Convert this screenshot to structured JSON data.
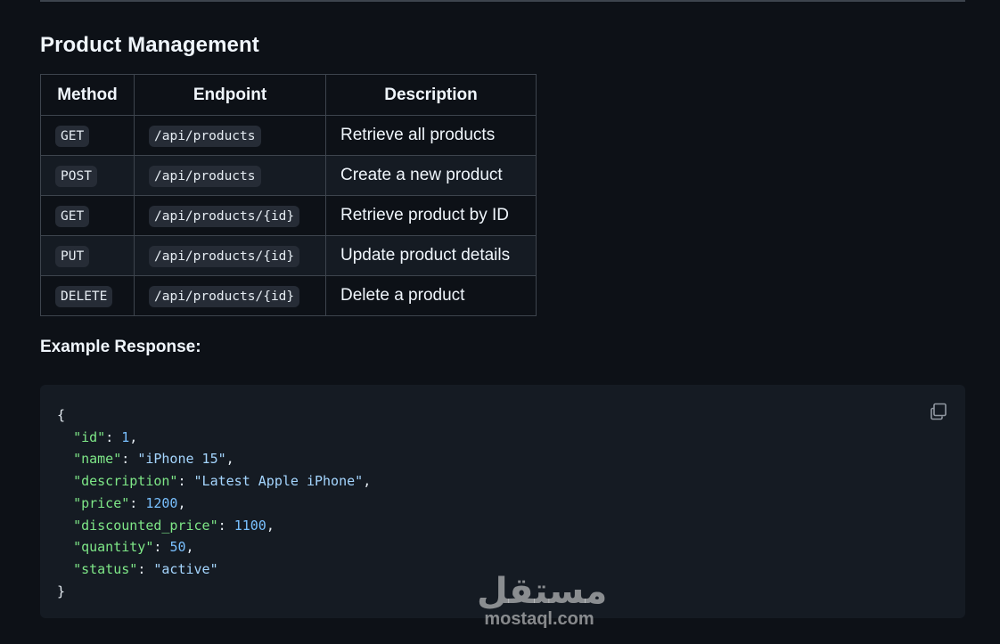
{
  "section": {
    "title": "Product Management"
  },
  "table": {
    "headers": [
      "Method",
      "Endpoint",
      "Description"
    ],
    "rows": [
      {
        "method": "GET",
        "endpoint": "/api/products",
        "description": "Retrieve all products"
      },
      {
        "method": "POST",
        "endpoint": "/api/products",
        "description": "Create a new product"
      },
      {
        "method": "GET",
        "endpoint": "/api/products/{id}",
        "description": "Retrieve product by ID"
      },
      {
        "method": "PUT",
        "endpoint": "/api/products/{id}",
        "description": "Update product details"
      },
      {
        "method": "DELETE",
        "endpoint": "/api/products/{id}",
        "description": "Delete a product"
      }
    ]
  },
  "example": {
    "label": "Example Response:",
    "open_brace": "{",
    "close_brace": "}",
    "fields": [
      {
        "key": "\"id\"",
        "value": "1",
        "type": "num",
        "comma": ","
      },
      {
        "key": "\"name\"",
        "value": "\"iPhone 15\"",
        "type": "str",
        "comma": ","
      },
      {
        "key": "\"description\"",
        "value": "\"Latest Apple iPhone\"",
        "type": "str",
        "comma": ","
      },
      {
        "key": "\"price\"",
        "value": "1200",
        "type": "num",
        "comma": ","
      },
      {
        "key": "\"discounted_price\"",
        "value": "1100",
        "type": "num",
        "comma": ","
      },
      {
        "key": "\"quantity\"",
        "value": "50",
        "type": "num",
        "comma": ","
      },
      {
        "key": "\"status\"",
        "value": "\"active\"",
        "type": "str",
        "comma": ""
      }
    ],
    "copy_icon": "copy-icon"
  },
  "watermark": {
    "arabic": "مستقل",
    "latin": "mostaql.com"
  },
  "colors": {
    "background": "#0d1117",
    "code_background": "#151b23",
    "border": "#3d444d",
    "json_key": "#7ee787",
    "json_string": "#a5d6ff",
    "json_number": "#79c0ff"
  }
}
